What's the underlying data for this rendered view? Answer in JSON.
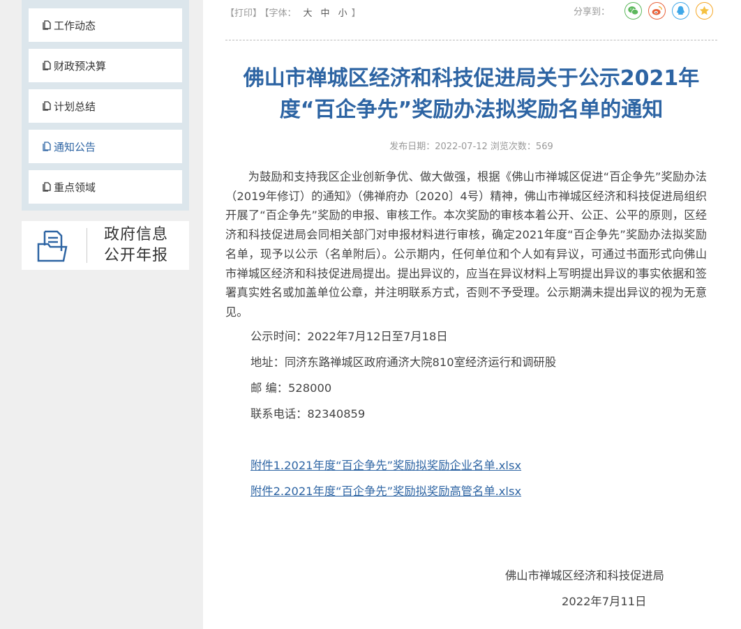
{
  "sidebar": {
    "items": [
      {
        "label": "工作动态"
      },
      {
        "label": "财政预决算"
      },
      {
        "label": "计划总结"
      },
      {
        "label": "通知公告"
      },
      {
        "label": "重点领域"
      }
    ],
    "annual_report": {
      "line1": "政府信息",
      "line2": "公开年报"
    }
  },
  "toolbar": {
    "print": "【打印】",
    "font_label": "【字体：",
    "font_large": "大",
    "font_medium": "中",
    "font_small": "小",
    "font_close": "】",
    "share_label": "分享到：",
    "share_icons": [
      "wechat-icon",
      "weibo-icon",
      "qq-icon",
      "qzone-icon"
    ],
    "share_colors": {
      "wechat": "#5cb85c",
      "weibo": "#e8613a",
      "qq": "#3fa7e8",
      "qzone": "#f5a623"
    }
  },
  "article": {
    "title": "佛山市禅城区经济和科技促进局关于公示2021年度“百企争先”奖励办法拟奖励名单的通知",
    "title_line1": "佛山市禅城区经济和科技促进局关于公示2021年",
    "title_line2": "度“百企争先”奖励办法拟奖励名单的通知",
    "meta": "发布日期：2022-07-12  浏览次数：569",
    "body": "为鼓励和支持我区企业创新争优、做大做强，根据《佛山市禅城区促进“百企争先”奖励办法（2019年修订）的通知》（佛禅府办〔2020〕4号）精神，佛山市禅城区经济和科技促进局组织开展了“百企争先”奖励的申报、审核工作。本次奖励的审核本着公开、公正、公平的原则，区经济和科技促进局会同相关部门对申报材料进行审核，确定2021年度“百企争先”奖励办法拟奖励名单，现予以公示（名单附后）。公示期内，任何单位和个人如有异议，可通过书面形式向佛山市禅城区经济和科技促进局提出。提出异议的，应当在异议材料上写明提出异议的事实依据和签署真实姓名或加盖单位公章，并注明联系方式，否则不予受理。公示期满未提出异议的视为无意见。",
    "period": "公示时间：2022年7月12日至7月18日",
    "address": "地址：同济东路禅城区政府通济大院810室经济运行和调研股",
    "postcode": "邮 编：528000",
    "phone": "联系电话：82340859",
    "attachments": [
      "附件1.2021年度“百企争先”奖励拟奖励企业名单.xlsx",
      "附件2.2021年度“百企争先”奖励拟奖励高管名单.xlsx"
    ],
    "signature": "佛山市禅城区经济和科技促进局",
    "date": "2022年7月11日"
  },
  "colors": {
    "accent": "#2d64a3",
    "sidebar_bg": "#dce6ec",
    "page_bg": "#efefef"
  }
}
